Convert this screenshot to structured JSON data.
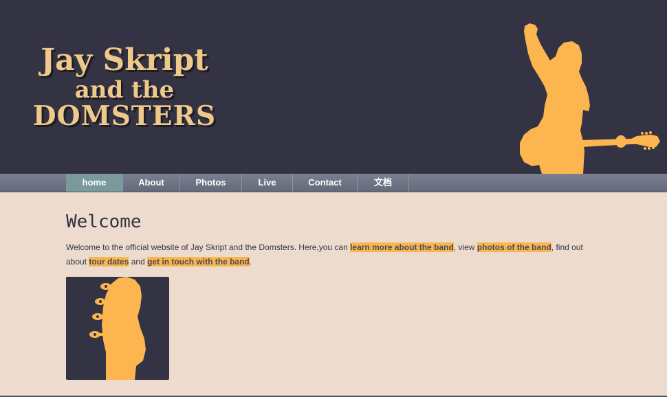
{
  "site": {
    "logo_line1": "Jay Skript",
    "logo_line2": "and the",
    "logo_line3": "DOMSTERS"
  },
  "nav": {
    "items": [
      {
        "label": "home",
        "active": true
      },
      {
        "label": "About"
      },
      {
        "label": "Photos"
      },
      {
        "label": "Live"
      },
      {
        "label": "Contact"
      },
      {
        "label": "文档"
      }
    ]
  },
  "main": {
    "heading": "Welcome",
    "intro_1": "Welcome to the official website of Jay Skript and the Domsters. Here,you can ",
    "link_band": "learn more about the band",
    "intro_2": ", view ",
    "link_photos": "photos of the band",
    "intro_3": ", find out about ",
    "link_tour": "tour dates",
    "intro_4": " and ",
    "link_contact": "get in touch with the band",
    "intro_5": "."
  },
  "colors": {
    "header_bg": "#343344",
    "accent": "#f9b650",
    "logo": "#eec98a",
    "body_bg": "#eddccd",
    "nav_active": "#79999a"
  },
  "icons": [
    "guitarist-silhouette",
    "bass-headstock-image"
  ]
}
